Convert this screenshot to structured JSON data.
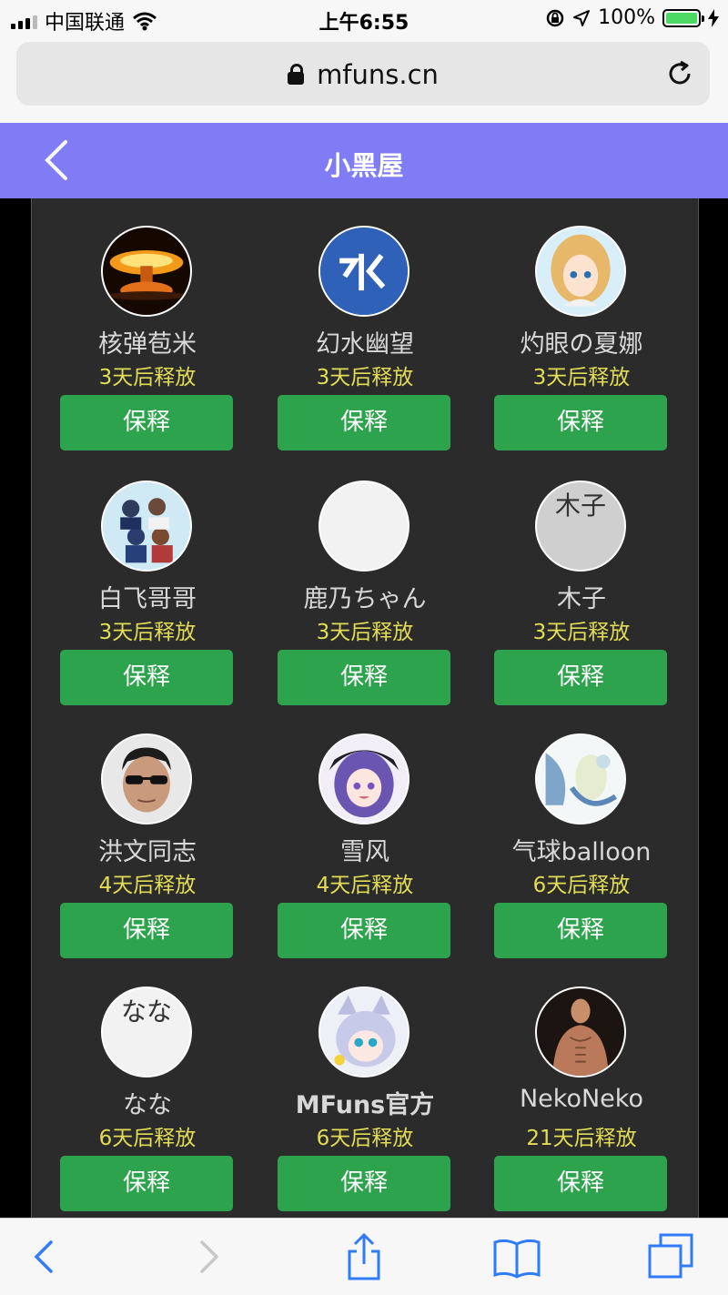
{
  "status_bar": {
    "carrier": "中国联通",
    "time": "上午6:55",
    "battery": "100%"
  },
  "browser": {
    "url": "mfuns.cn"
  },
  "header": {
    "title": "小黑屋"
  },
  "colors": {
    "header_bg": "#7f7cf6",
    "button_bg": "#2ea34d",
    "release_text": "#e2dd55",
    "content_bg": "#2b2b2b"
  },
  "users": [
    {
      "name": "核弹苞米",
      "release": "3天后释放",
      "button": "保释",
      "avatar": "explosion-avatar"
    },
    {
      "name": "幻水幽望",
      "release": "3天后释放",
      "button": "保释",
      "avatar": "water-glyph-avatar"
    },
    {
      "name": "灼眼の夏娜",
      "release": "3天后释放",
      "button": "保释",
      "avatar": "anime-girl-avatar"
    },
    {
      "name": "白飞哥哥",
      "release": "3天后释放",
      "button": "保释",
      "avatar": "anime-group-avatar"
    },
    {
      "name": "鹿乃ちゃん",
      "release": "3天后释放",
      "button": "保释",
      "avatar": "blank-avatar"
    },
    {
      "name": "木子",
      "release": "3天后释放",
      "button": "保释",
      "avatar": "text-avatar",
      "avatar_text": "木子"
    },
    {
      "name": "洪文同志",
      "release": "4天后释放",
      "button": "保释",
      "avatar": "man-sunglasses-avatar"
    },
    {
      "name": "雪风",
      "release": "4天后释放",
      "button": "保释",
      "avatar": "purple-hair-girl-avatar"
    },
    {
      "name": "气球balloon",
      "release": "6天后释放",
      "button": "保释",
      "avatar": "blue-illustration-avatar"
    },
    {
      "name": "なな",
      "release": "6天后释放",
      "button": "保释",
      "avatar": "text-avatar",
      "avatar_text": "なな"
    },
    {
      "name": "MFuns官方",
      "release": "6天后释放",
      "button": "保释",
      "avatar": "mascot-avatar"
    },
    {
      "name": "NekoNeko",
      "release": "21天后释放",
      "button": "保释",
      "avatar": "muscle-man-avatar"
    }
  ]
}
